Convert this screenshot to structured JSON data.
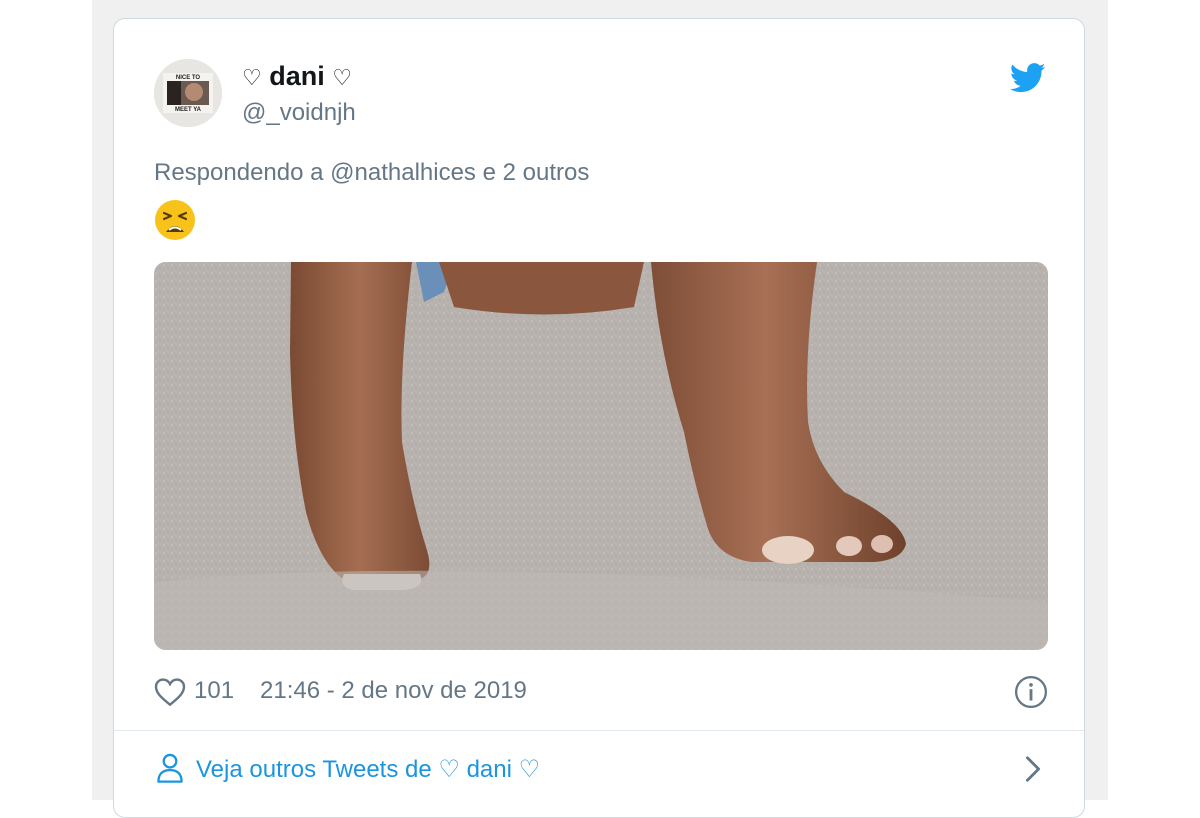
{
  "tweet": {
    "author": {
      "name_prefix": "♡",
      "name": "dani",
      "name_suffix": "♡",
      "handle": "@_voidnjh",
      "avatar_text_top": "NICE TO",
      "avatar_text_bottom": "MEET YA"
    },
    "reply_text": "Respondendo a @nathalhices e 2 outros",
    "body_emoji": "weary-face-emoji",
    "likes": "101",
    "timestamp": "21:46 - 2 de nov de 2019",
    "more_tweets_label": "Veja outros Tweets de ♡ dani ♡"
  },
  "icons": {
    "brand": "twitter-bird-icon",
    "like": "heart-outline-icon",
    "info": "info-icon",
    "profile": "person-outline-icon",
    "chevron": "chevron-right-icon"
  },
  "colors": {
    "twitter_blue": "#1da1f2",
    "link_blue": "#1b95e0",
    "text_primary": "#14171a",
    "text_secondary": "#657786",
    "border": "#cfd9de"
  }
}
